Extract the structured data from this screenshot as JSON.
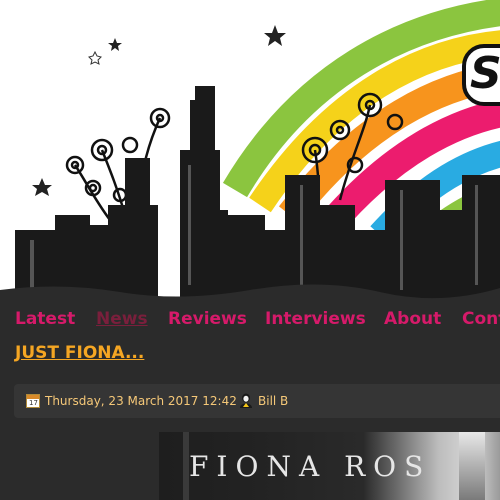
{
  "site": {
    "logo_text": "S"
  },
  "nav": {
    "items": [
      {
        "label": "Latest"
      },
      {
        "label": "News"
      },
      {
        "label": "Reviews"
      },
      {
        "label": "Interviews"
      },
      {
        "label": "About"
      },
      {
        "label": "Cont"
      }
    ],
    "active": "News"
  },
  "article": {
    "title": "JUST FIONA...",
    "date": "Thursday, 23 March 2017 12:42",
    "author": "Bill B",
    "calendar_day": "17",
    "image_text": "FIONA ROS"
  },
  "colors": {
    "background": "#2b2b2b",
    "nav_link": "#d61a6a",
    "nav_active": "#7a1f3c",
    "title": "#f5a623",
    "meta_text": "#f5c878"
  },
  "icons": [
    "calendar-icon",
    "user-icon"
  ]
}
